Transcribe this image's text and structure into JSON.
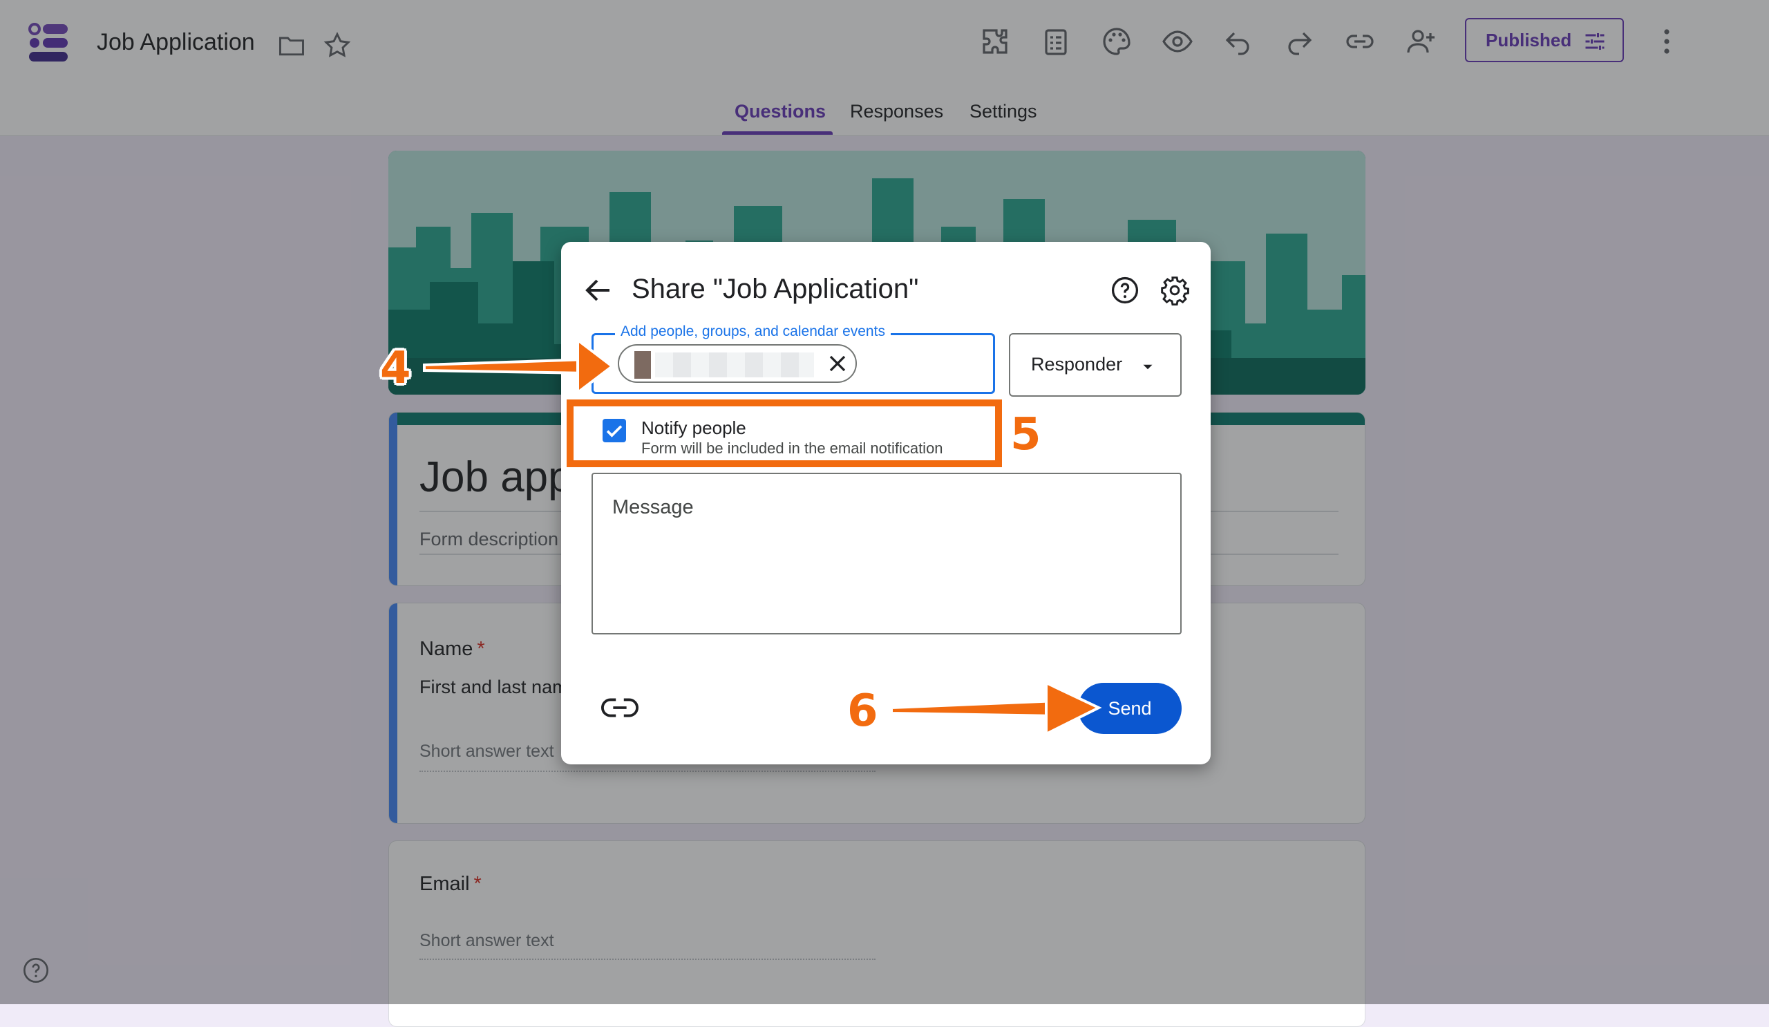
{
  "app": {
    "title": "Job Application",
    "icons": [
      "forms-logo-icon",
      "folder-icon",
      "star-icon"
    ]
  },
  "toolbar": {
    "icons": [
      "addon-icon",
      "customize-icon",
      "palette-icon",
      "preview-icon",
      "undo-icon",
      "redo-icon",
      "link-icon",
      "add-collaborator-icon",
      "more-vert-icon"
    ],
    "published_label": "Published"
  },
  "tabs": [
    {
      "label": "Questions",
      "active": true
    },
    {
      "label": "Responses",
      "active": false
    },
    {
      "label": "Settings",
      "active": false
    }
  ],
  "form": {
    "title": "Job app",
    "description_placeholder": "Form description",
    "questions": [
      {
        "title": "Name",
        "required_mark": "*",
        "description": "First and last nam",
        "answer_placeholder": "Short answer text"
      },
      {
        "title": "Email",
        "required_mark": "*",
        "answer_placeholder": "Short answer text"
      }
    ]
  },
  "dialog": {
    "title": "Share \"Job Application\"",
    "people_label": "Add people, groups, and calendar events",
    "role": "Responder",
    "notify_label": "Notify people",
    "notify_checked": true,
    "notify_sub": "Form will be included in the email notification",
    "message_placeholder": "Message",
    "send_label": "Send"
  },
  "annotations": {
    "steps": [
      "4",
      "5",
      "6"
    ],
    "color": "#f26b0f"
  },
  "colors": {
    "brand": "#673ab7",
    "primary_button": "#0b57d0",
    "field_focus": "#1a73e8",
    "header_teal": "#0d7b6e",
    "page_bg": "#f0ebf8"
  }
}
